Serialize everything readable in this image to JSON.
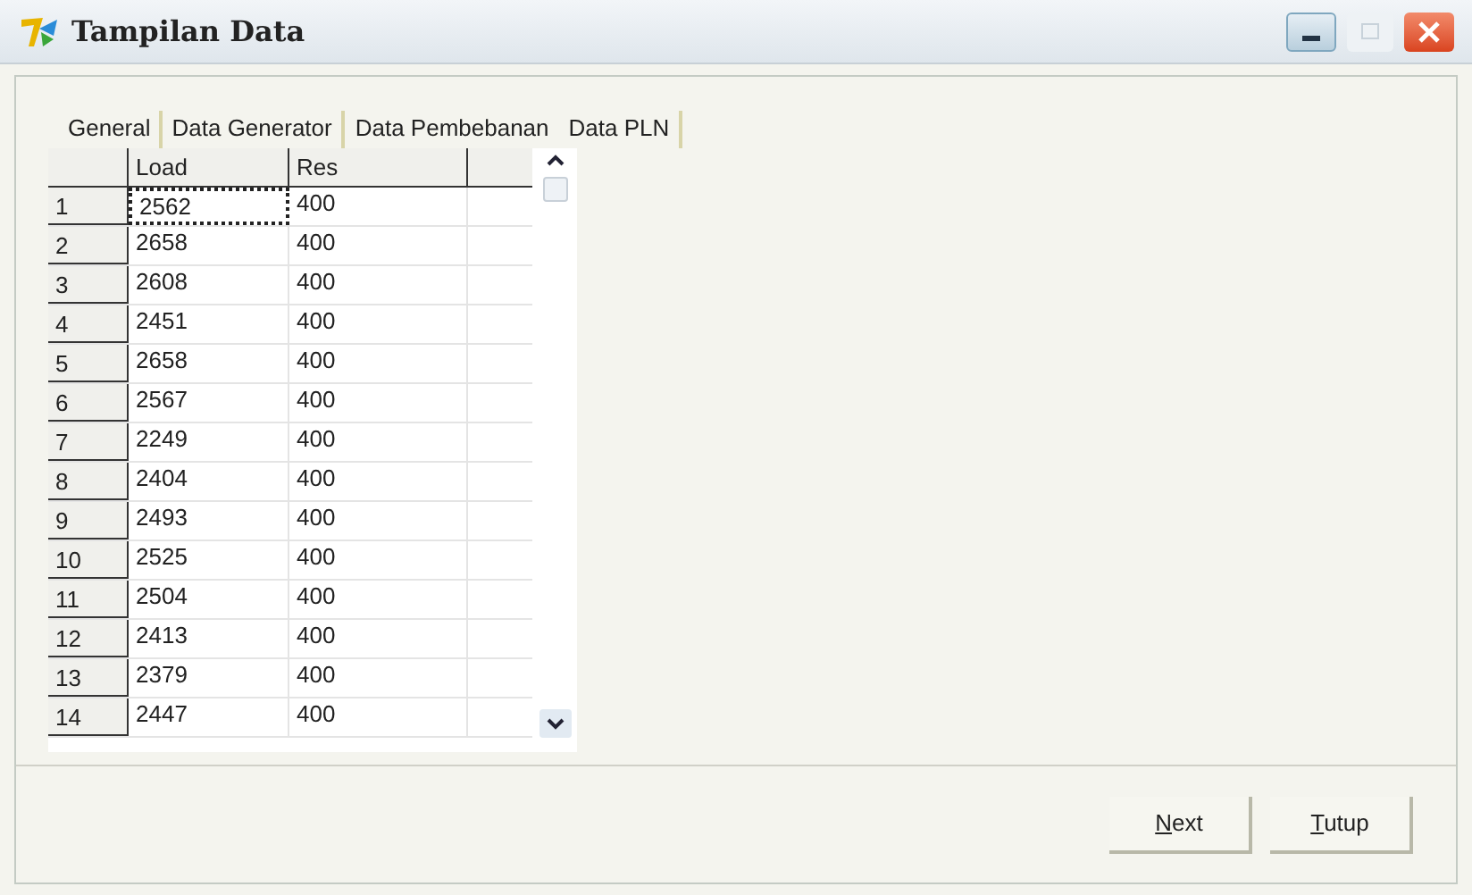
{
  "window": {
    "title": "Tampilan Data"
  },
  "tabs": [
    {
      "label": "General",
      "selected": false
    },
    {
      "label": "Data Generator",
      "selected": false
    },
    {
      "label": "Data Pembebanan",
      "selected": true
    },
    {
      "label": "Data PLN",
      "selected": false
    }
  ],
  "table": {
    "columns": [
      "Load",
      "Res"
    ],
    "rows": [
      {
        "number": "1",
        "cells": [
          "2562",
          "400"
        ],
        "focused": true
      },
      {
        "number": "2",
        "cells": [
          "2658",
          "400"
        ],
        "focused": false
      },
      {
        "number": "3",
        "cells": [
          "2608",
          "400"
        ],
        "focused": false
      },
      {
        "number": "4",
        "cells": [
          "2451",
          "400"
        ],
        "focused": false
      },
      {
        "number": "5",
        "cells": [
          "2658",
          "400"
        ],
        "focused": false
      },
      {
        "number": "6",
        "cells": [
          "2567",
          "400"
        ],
        "focused": false
      },
      {
        "number": "7",
        "cells": [
          "2249",
          "400"
        ],
        "focused": false
      },
      {
        "number": "8",
        "cells": [
          "2404",
          "400"
        ],
        "focused": false
      },
      {
        "number": "9",
        "cells": [
          "2493",
          "400"
        ],
        "focused": false
      },
      {
        "number": "10",
        "cells": [
          "2525",
          "400"
        ],
        "focused": false
      },
      {
        "number": "11",
        "cells": [
          "2504",
          "400"
        ],
        "focused": false
      },
      {
        "number": "12",
        "cells": [
          "2413",
          "400"
        ],
        "focused": false
      },
      {
        "number": "13",
        "cells": [
          "2379",
          "400"
        ],
        "focused": false
      },
      {
        "number": "14",
        "cells": [
          "2447",
          "400"
        ],
        "focused": false
      }
    ]
  },
  "buttons": [
    {
      "label": "Next",
      "first_letter_underlined": true
    },
    {
      "label": "Tutup",
      "first_letter_underlined": true
    }
  ]
}
